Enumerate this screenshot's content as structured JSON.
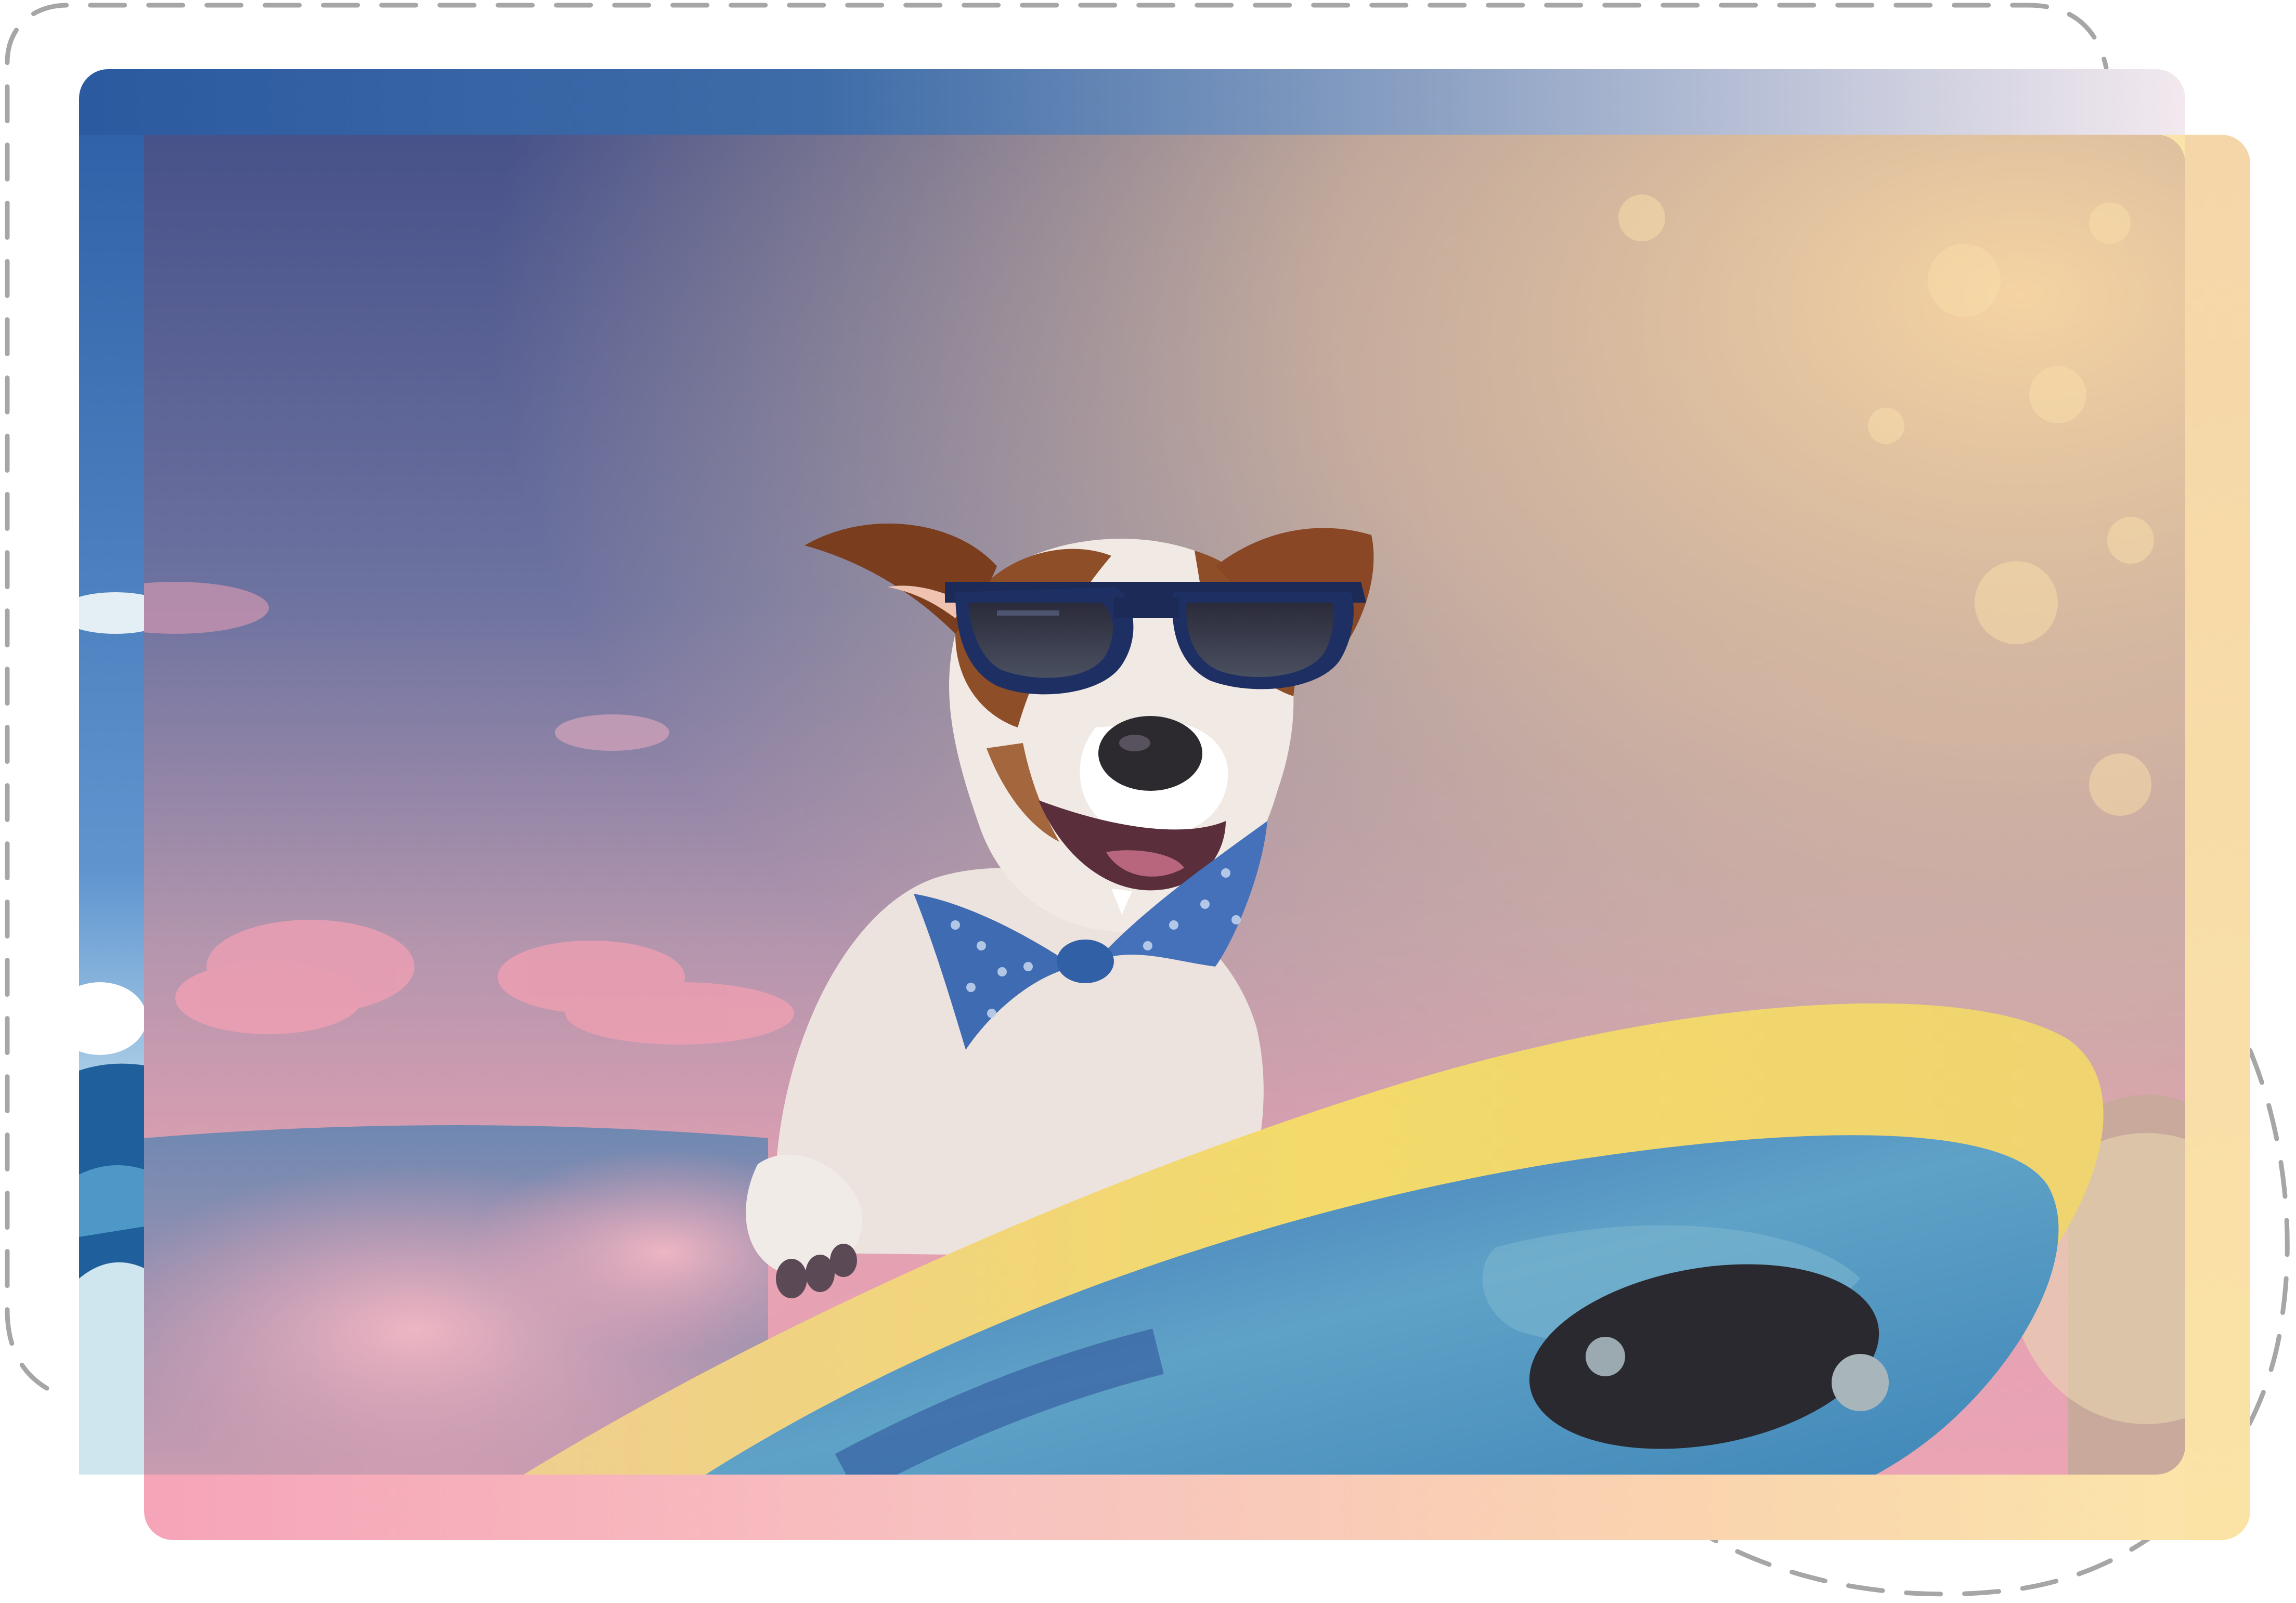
{
  "image": {
    "subject": "jack-russell-terrier",
    "accessories": [
      "sunglasses",
      "bow-tie"
    ],
    "props": [
      "surfboard"
    ],
    "scene": "ocean-wave"
  },
  "palette": {
    "sky_top": "#45508a",
    "sky_mid": "#8e86a8",
    "sky_bottom": "#e9a3b3",
    "warm_glow": "#f6d9a8",
    "ocean": "#2f6fa8",
    "spray": "#e8a8b6",
    "board_rim": "#f2d86a",
    "board_body": "#4d93c4",
    "board_dark": "#1c2a38",
    "glasses": "#1d2e5a",
    "bowtie": "#3e6bb5",
    "fur_white": "#f2ece8",
    "fur_brown": "#8a4a26",
    "back_card_gradient": [
      "#2c5aa0",
      "#3e6ca8",
      "#8ea3c4",
      "#f3e9ef"
    ],
    "front_card_gradient": [
      "#f6a4b8",
      "#f8c2c0",
      "#fad5ae",
      "#fbe6a8"
    ],
    "outline": "#a6a6a6"
  }
}
